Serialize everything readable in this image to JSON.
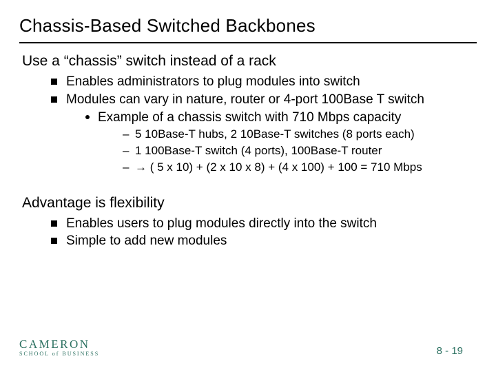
{
  "title": "Chassis-Based Switched Backbones",
  "section1": {
    "heading": "Use a “chassis” switch instead of a rack",
    "bullets": [
      "Enables administrators to plug modules into switch",
      "Modules can vary in nature, router or 4-port 100Base T switch"
    ],
    "sub": {
      "heading": "Example of a chassis switch with 710 Mbps capacity",
      "items": [
        "5 10Base-T hubs, 2 10Base-T switches (8 ports each)",
        "1 100Base-T switch (4 ports), 100Base-T router",
        "→ ( 5 x 10) + (2 x 10 x 8) + (4 x 100) + 100 = 710 Mbps"
      ]
    }
  },
  "section2": {
    "heading": "Advantage is flexibility",
    "bullets": [
      "Enables users to plug modules directly into the switch",
      "Simple to add new modules"
    ]
  },
  "logo": {
    "name": "CAMERON",
    "sub": "SCHOOL of BUSINESS"
  },
  "footer": "8 - 19"
}
